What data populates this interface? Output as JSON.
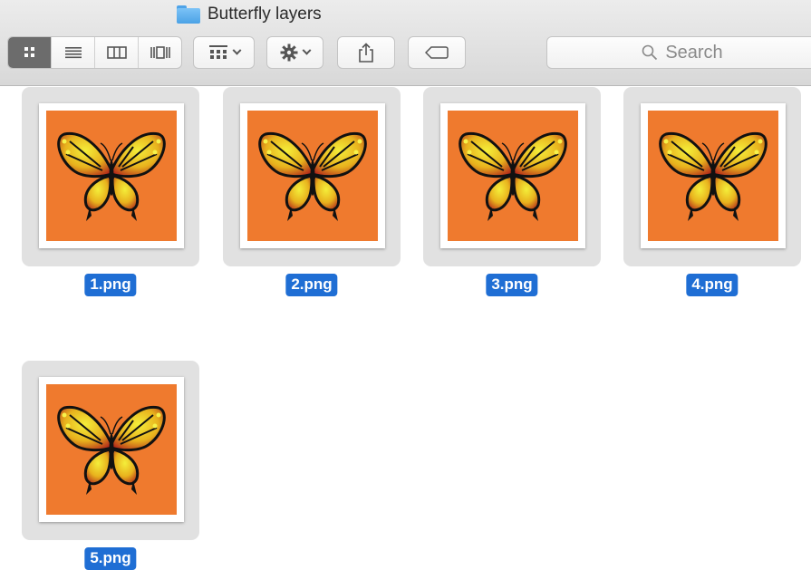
{
  "window": {
    "title": "Butterfly layers"
  },
  "toolbar": {
    "view_modes": [
      {
        "name": "view-icon-button",
        "icon": "icon-grid-icon",
        "active": true
      },
      {
        "name": "view-list-button",
        "icon": "list-view-icon",
        "active": false
      },
      {
        "name": "view-columns-button",
        "icon": "column-view-icon",
        "active": false
      },
      {
        "name": "view-coverflow-button",
        "icon": "coverflow-view-icon",
        "active": false
      }
    ],
    "arrange_icon": "arrange-icon",
    "action_icon": "gear-icon",
    "share_icon": "share-icon",
    "tags_icon": "tag-icon",
    "search_placeholder": "Search"
  },
  "files": [
    {
      "name": "1.png",
      "selected": true
    },
    {
      "name": "2.png",
      "selected": true
    },
    {
      "name": "3.png",
      "selected": true
    },
    {
      "name": "4.png",
      "selected": true
    },
    {
      "name": "5.png",
      "selected": true
    }
  ],
  "colors": {
    "thumbnail_background": "#ef7a2e",
    "selection": "#1f6ed4"
  }
}
